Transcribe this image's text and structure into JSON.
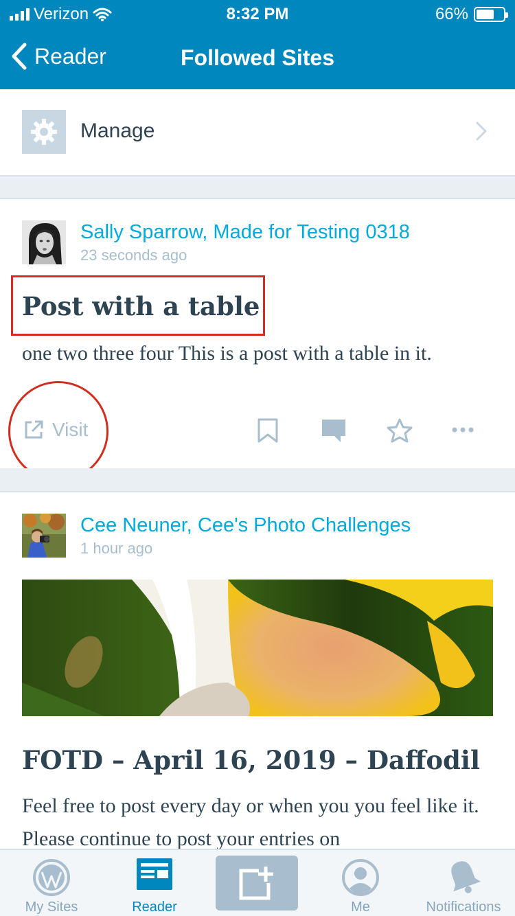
{
  "status_bar": {
    "carrier": "Verizon",
    "time": "8:32 PM",
    "battery": "66%",
    "battery_level": 0.66
  },
  "nav": {
    "back_label": "Reader",
    "title": "Followed Sites"
  },
  "manage": {
    "label": "Manage",
    "icon": "gear-icon"
  },
  "posts": [
    {
      "author": "Sally Sparrow, Made for Testing 0318",
      "time_ago": "23 seconds ago",
      "title": "Post with a table",
      "excerpt": "one two three four This is a post with a table in it.",
      "actions": {
        "visit_label": "Visit"
      }
    },
    {
      "author": "Cee Neuner, Cee's Photo Challenges",
      "time_ago": "1 hour ago",
      "title": "FOTD – April 16, 2019 – Daffodil",
      "excerpt": "Feel free to post every day or when you you feel like it.  Please continue to post your entries on"
    }
  ],
  "tabbar": {
    "tabs": [
      {
        "label": "My Sites",
        "icon": "wordpress-icon"
      },
      {
        "label": "Reader",
        "icon": "reader-icon",
        "active": true
      },
      {
        "label": "",
        "icon": "write-post-icon"
      },
      {
        "label": "Me",
        "icon": "user-icon"
      },
      {
        "label": "Notifications",
        "icon": "bell-icon"
      }
    ]
  },
  "colors": {
    "header": "#0087be",
    "link": "#00aadc",
    "muted": "#a8bece",
    "text": "#2e4453",
    "annotation": "#d22d1f"
  }
}
